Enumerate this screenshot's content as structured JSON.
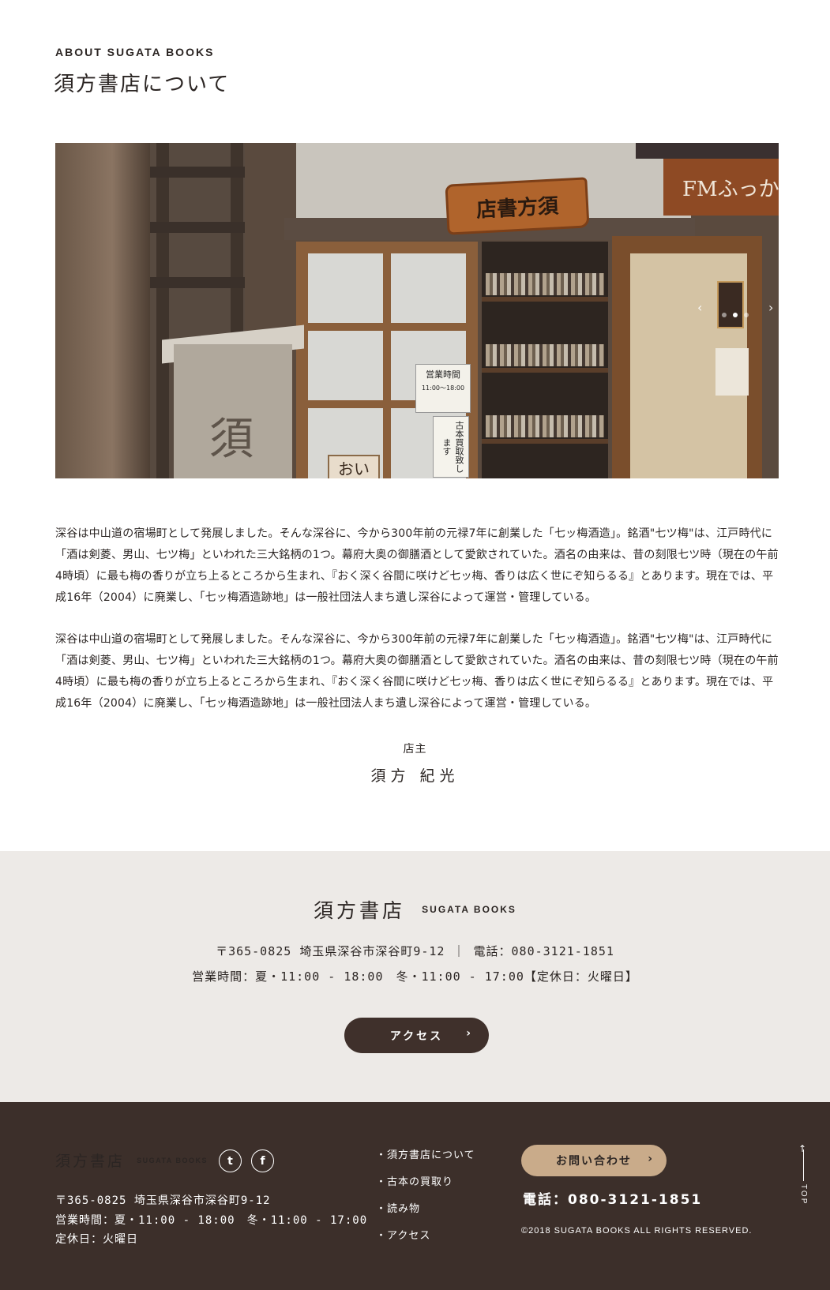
{
  "header": {
    "eyebrow": "ABOUT SUGATA BOOKS",
    "title": "須方書店について"
  },
  "hero": {
    "prev_label": "‹",
    "next_label": "›",
    "sign_text": "店書方須",
    "hours_card_title": "営業時間",
    "hours_card_text": "11:00〜18:00",
    "buy_card_text": "古本買取致します",
    "fm_sign_text": "FMふっか",
    "slide_count": 3,
    "active_slide": 1
  },
  "about": {
    "paragraph_1": "深谷は中山道の宿場町として発展しました。そんな深谷に、今から300年前の元禄7年に創業した「七ッ梅酒造」。銘酒\"七ツ梅\"は、江戸時代に「酒は剣菱、男山、七ツ梅」といわれた三大銘柄の1つ。幕府大奥の御膳酒として愛飲されていた。酒名の由来は、昔の刻限七ツ時（現在の午前4時頃）に最も梅の香りが立ち上るところから生まれ、『おく深く谷間に咲けど七ッ梅、香りは広く世にぞ知らるる』とあります。現在では、平成16年（2004）に廃業し、「七ッ梅酒造跡地」は一般社団法人まち遺し深谷によって運営・管理している。",
    "paragraph_2": "深谷は中山道の宿場町として発展しました。そんな深谷に、今から300年前の元禄7年に創業した「七ッ梅酒造」。銘酒\"七ツ梅\"は、江戸時代に「酒は剣菱、男山、七ツ梅」といわれた三大銘柄の1つ。幕府大奥の御膳酒として愛飲されていた。酒名の由来は、昔の刻限七ツ時（現在の午前4時頃）に最も梅の香りが立ち上るところから生まれ、『おく深く谷間に咲けど七ッ梅、香りは広く世にぞ知らるる』とあります。現在では、平成16年（2004）に廃業し、「七ッ梅酒造跡地」は一般社団法人まち遺し深谷によって運営・管理している。",
    "owner_role": "店主",
    "owner_name": "須方 紀光"
  },
  "info": {
    "brand_jp": "須方書店",
    "brand_en": "SUGATA BOOKS",
    "address_line": "〒365-0825 埼玉県深谷市深谷町9-12 ｜ 電話：080-3121-1851",
    "hours_line": "営業時間：夏・11:00 - 18:00　冬・11:00 - 17:00【定休日：火曜日】",
    "access_button": "アクセス",
    "chevron": "›"
  },
  "footer": {
    "brand_jp": "須方書店",
    "brand_en": "SUGATA BOOKS",
    "twitter_icon": "twitter-icon",
    "facebook_icon": "facebook-icon",
    "twitter_glyph": "t",
    "facebook_glyph": "f",
    "address": "〒365-0825 埼玉県深谷市深谷町9-12",
    "hours": "営業時間：夏・11:00 - 18:00　冬・11:00 - 17:00",
    "closed": "定休日：火曜日",
    "nav": [
      "・須方書店について",
      "・古本の買取り",
      "・読み物",
      "・アクセス"
    ],
    "contact_button": "お問い合わせ",
    "chevron": "›",
    "tel": "電話：080-3121-1851",
    "copyright": "©2018 SUGATA BOOKS ALL RIGHTS RESERVED.",
    "to_top": "TOP",
    "to_top_arrow": "↑"
  },
  "colors": {
    "dark_brown": "#3c2f2a",
    "band_beige": "#edeae7",
    "contact_tan": "#c9ab8a",
    "text": "#2b2523"
  }
}
